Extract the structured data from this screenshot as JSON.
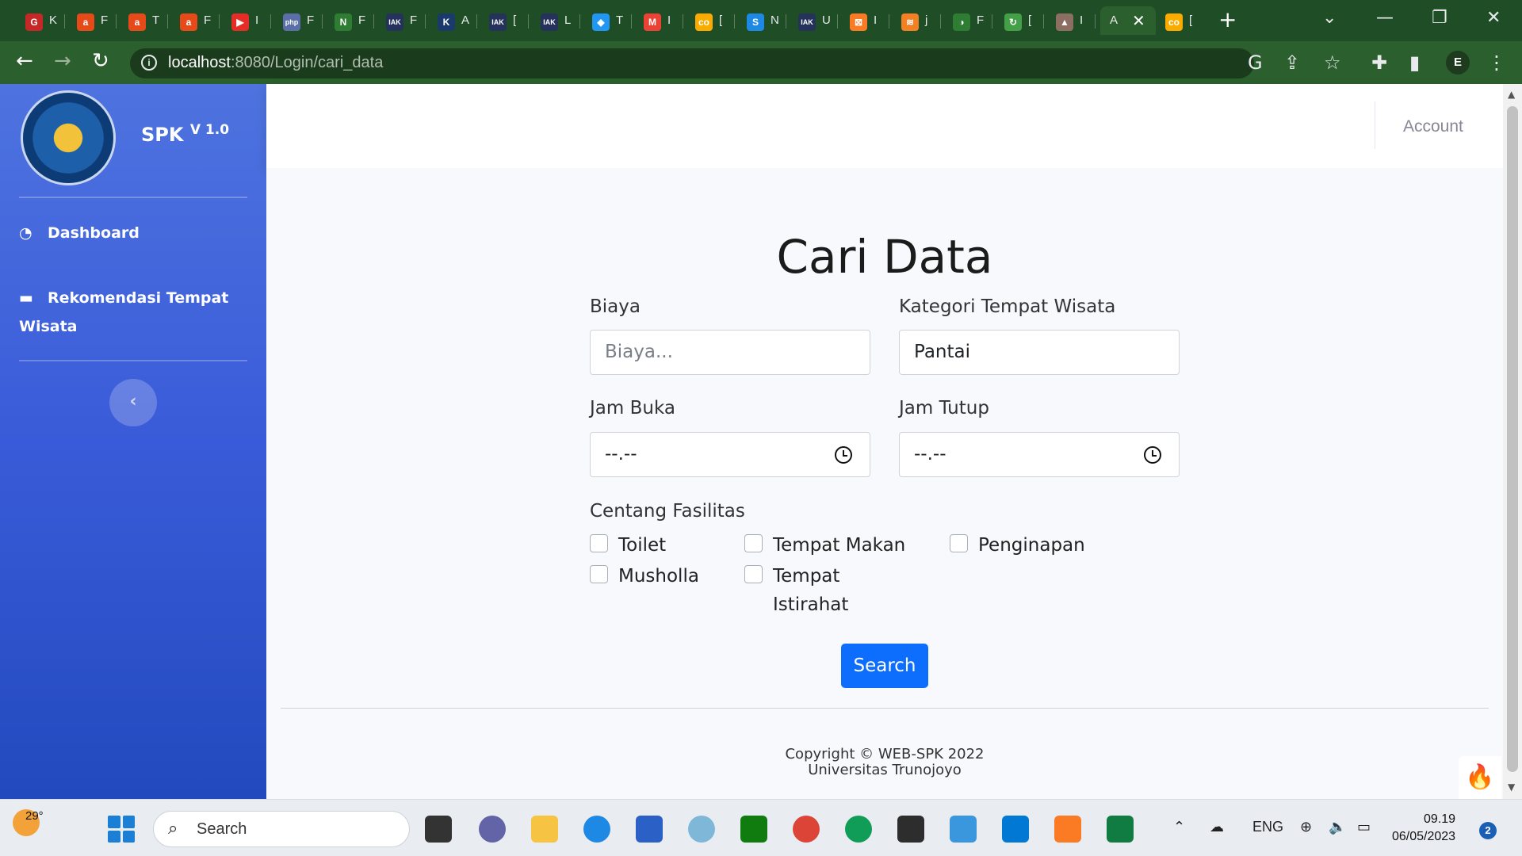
{
  "browser": {
    "tabs": [
      {
        "fav": "G",
        "color": "#c62828",
        "title": "K"
      },
      {
        "fav": "a",
        "color": "#e64a19",
        "title": "F"
      },
      {
        "fav": "a",
        "color": "#e64a19",
        "title": "T"
      },
      {
        "fav": "a",
        "color": "#e64a19",
        "title": "F"
      },
      {
        "fav": "▶",
        "color": "#e52d27",
        "title": "I"
      },
      {
        "fav": "php",
        "color": "#5b6ea8",
        "title": "F"
      },
      {
        "fav": "N",
        "color": "#2e7d32",
        "title": "F"
      },
      {
        "fav": "IAK",
        "color": "#24325c",
        "title": "F"
      },
      {
        "fav": "K",
        "color": "#1a3a6b",
        "title": "A"
      },
      {
        "fav": "IAK",
        "color": "#24325c",
        "title": "["
      },
      {
        "fav": "IAK",
        "color": "#24325c",
        "title": "L"
      },
      {
        "fav": "◆",
        "color": "#2196f3",
        "title": "T"
      },
      {
        "fav": "M",
        "color": "#ea4335",
        "title": "I"
      },
      {
        "fav": "co",
        "color": "#f9ab00",
        "title": "["
      },
      {
        "fav": "S",
        "color": "#1e88e5",
        "title": "N"
      },
      {
        "fav": "IAK",
        "color": "#24325c",
        "title": "U"
      },
      {
        "fav": "⊠",
        "color": "#fb7a24",
        "title": "I"
      },
      {
        "fav": "≋",
        "color": "#f48024",
        "title": "j"
      },
      {
        "fav": "◑",
        "color": "#2e7d32",
        "title": "F"
      },
      {
        "fav": "↻",
        "color": "#43a047",
        "title": "["
      },
      {
        "fav": "▲",
        "color": "#8d6e63",
        "title": "I"
      }
    ],
    "active_tab": {
      "title": "A",
      "close": "✕"
    },
    "last_tab": {
      "fav": "co",
      "color": "#f9ab00",
      "title": "["
    },
    "new_tab": "+",
    "url_host": "localhost",
    "url_path": ":8080/Login/cari_data",
    "profile_initial": "E"
  },
  "sidebar": {
    "brand": "SPK",
    "version": "V 1.0",
    "items": [
      {
        "label": "Dashboard",
        "icon": "gauge-icon"
      },
      {
        "label": "Rekomendasi Tempat Wisata",
        "icon": "folder-icon"
      }
    ],
    "toggle": "‹"
  },
  "topbar": {
    "account": "Account"
  },
  "form": {
    "title": "Cari Data",
    "biaya_label": "Biaya",
    "biaya_placeholder": "Biaya...",
    "kategori_label": "Kategori Tempat Wisata",
    "kategori_value": "Pantai",
    "jam_buka_label": "Jam Buka",
    "jam_buka_value": "--.--",
    "jam_tutup_label": "Jam Tutup",
    "jam_tutup_value": "--.--",
    "fasilitas_label": "Centang Fasilitas",
    "fasilitas": [
      "Toilet",
      "Tempat Makan",
      "Penginapan",
      "Musholla",
      "Tempat Istirahat"
    ],
    "search_button": "Search"
  },
  "footer": {
    "line1": "Copyright © WEB-SPK 2022",
    "line2": "Universitas Trunojoyo"
  },
  "taskbar": {
    "temperature": "29°",
    "search_text": "Search",
    "lang": "ENG",
    "time": "09.19",
    "date": "06/05/2023",
    "notifications": "2"
  }
}
